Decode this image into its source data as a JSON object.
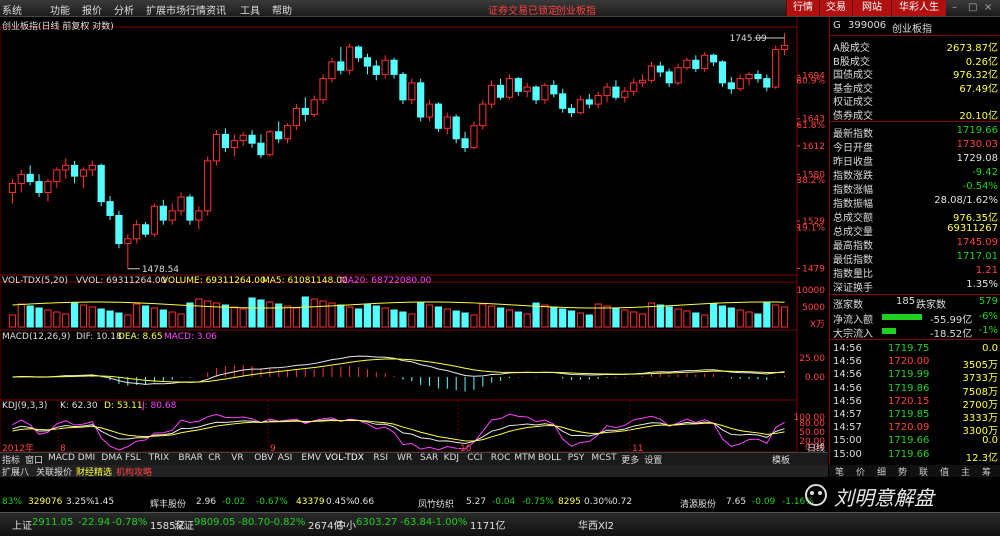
{
  "menu": {
    "items": [
      "系统",
      "功能",
      "报价",
      "分析",
      "扩展市场行情",
      "资讯",
      "工具",
      "帮助"
    ],
    "warnings": [
      "证券交易已锁定",
      "创业板指"
    ],
    "right_buttons": [
      "行情",
      "交易",
      "网站",
      "华彩人生"
    ]
  },
  "chart": {
    "title": "创业板指(日线 前复权 对数)",
    "price_labels": [
      "1694",
      "80.9%",
      "1643",
      "61.8%",
      "1612",
      "1580",
      "38.2%",
      "1529",
      "19.1%",
      "1479"
    ],
    "high_marker": "1745.09",
    "low_marker": "1478.54",
    "vol_header": {
      "name": "VOL-TDX(5,20)",
      "vvol": "VVOL: 69311264.00",
      "volume": "VOLUME: 69311264.00",
      "ma5": "MA5: 61081148.00",
      "ma20": "MA20: 68722080.00"
    },
    "vol_axis": [
      "10000",
      "5000",
      "X万"
    ],
    "macd_header": {
      "name": "MACD(12,26,9)",
      "dif": "DIF: 10.18",
      "dea": "DEA: 8.65",
      "macd": "MACD: 3.06"
    },
    "macd_axis": [
      "25.00",
      "0.00"
    ],
    "kdj_header": {
      "name": "KDJ(9,3,3)",
      "k": "K: 62.30",
      "d": "D: 53.11",
      "j": "J: 80.68"
    },
    "kdj_axis": [
      "100.00",
      "80.00",
      "50.00",
      "20.00",
      "0.00"
    ],
    "x_labels": [
      "2012年",
      "8",
      "9",
      "10",
      "11"
    ],
    "period": "日线"
  },
  "chart_data": {
    "type": "candlestick",
    "ohlc": [
      [
        1560,
        1575,
        1548,
        1570
      ],
      [
        1570,
        1585,
        1560,
        1580
      ],
      [
        1580,
        1590,
        1568,
        1572
      ],
      [
        1572,
        1580,
        1555,
        1560
      ],
      [
        1560,
        1575,
        1550,
        1572
      ],
      [
        1572,
        1588,
        1565,
        1585
      ],
      [
        1585,
        1598,
        1575,
        1590
      ],
      [
        1590,
        1595,
        1570,
        1578
      ],
      [
        1578,
        1588,
        1565,
        1585
      ],
      [
        1585,
        1595,
        1578,
        1590
      ],
      [
        1590,
        1592,
        1545,
        1550
      ],
      [
        1550,
        1556,
        1530,
        1535
      ],
      [
        1535,
        1540,
        1500,
        1505
      ],
      [
        1505,
        1515,
        1478.54,
        1510
      ],
      [
        1510,
        1530,
        1505,
        1525
      ],
      [
        1525,
        1528,
        1512,
        1515
      ],
      [
        1515,
        1548,
        1512,
        1545
      ],
      [
        1545,
        1552,
        1525,
        1530
      ],
      [
        1530,
        1548,
        1525,
        1540
      ],
      [
        1540,
        1560,
        1535,
        1555
      ],
      [
        1555,
        1558,
        1525,
        1530
      ],
      [
        1530,
        1545,
        1520,
        1540
      ],
      [
        1540,
        1600,
        1535,
        1595
      ],
      [
        1595,
        1630,
        1590,
        1625
      ],
      [
        1625,
        1632,
        1605,
        1610
      ],
      [
        1610,
        1625,
        1600,
        1618
      ],
      [
        1618,
        1628,
        1612,
        1624
      ],
      [
        1624,
        1630,
        1610,
        1615
      ],
      [
        1615,
        1625,
        1598,
        1602
      ],
      [
        1602,
        1630,
        1600,
        1628
      ],
      [
        1628,
        1640,
        1615,
        1620
      ],
      [
        1620,
        1638,
        1615,
        1635
      ],
      [
        1635,
        1660,
        1630,
        1655
      ],
      [
        1655,
        1668,
        1640,
        1648
      ],
      [
        1648,
        1670,
        1645,
        1665
      ],
      [
        1665,
        1695,
        1660,
        1690
      ],
      [
        1690,
        1715,
        1685,
        1710
      ],
      [
        1710,
        1728,
        1695,
        1700
      ],
      [
        1700,
        1732,
        1695,
        1728
      ],
      [
        1728,
        1730,
        1710,
        1715
      ],
      [
        1715,
        1720,
        1695,
        1705
      ],
      [
        1705,
        1712,
        1688,
        1695
      ],
      [
        1695,
        1718,
        1690,
        1712
      ],
      [
        1712,
        1715,
        1690,
        1695
      ],
      [
        1695,
        1698,
        1660,
        1665
      ],
      [
        1665,
        1690,
        1660,
        1685
      ],
      [
        1685,
        1690,
        1640,
        1645
      ],
      [
        1645,
        1665,
        1640,
        1660
      ],
      [
        1660,
        1662,
        1628,
        1632
      ],
      [
        1632,
        1650,
        1625,
        1645
      ],
      [
        1645,
        1648,
        1615,
        1620
      ],
      [
        1620,
        1628,
        1605,
        1610
      ],
      [
        1610,
        1640,
        1608,
        1635
      ],
      [
        1635,
        1665,
        1630,
        1660
      ],
      [
        1660,
        1688,
        1655,
        1682
      ],
      [
        1682,
        1690,
        1665,
        1668
      ],
      [
        1668,
        1695,
        1665,
        1690
      ],
      [
        1690,
        1692,
        1670,
        1675
      ],
      [
        1675,
        1685,
        1668,
        1680
      ],
      [
        1680,
        1682,
        1660,
        1665
      ],
      [
        1665,
        1685,
        1660,
        1682
      ],
      [
        1682,
        1688,
        1668,
        1672
      ],
      [
        1672,
        1678,
        1650,
        1655
      ],
      [
        1655,
        1660,
        1645,
        1650
      ],
      [
        1650,
        1670,
        1648,
        1665
      ],
      [
        1665,
        1672,
        1655,
        1660
      ],
      [
        1660,
        1675,
        1655,
        1670
      ],
      [
        1670,
        1685,
        1662,
        1680
      ],
      [
        1680,
        1688,
        1665,
        1668
      ],
      [
        1668,
        1680,
        1662,
        1675
      ],
      [
        1675,
        1690,
        1670,
        1685
      ],
      [
        1685,
        1695,
        1680,
        1688
      ],
      [
        1688,
        1710,
        1685,
        1705
      ],
      [
        1705,
        1710,
        1692,
        1698
      ],
      [
        1698,
        1702,
        1680,
        1685
      ],
      [
        1685,
        1708,
        1682,
        1703
      ],
      [
        1703,
        1715,
        1700,
        1712
      ],
      [
        1712,
        1718,
        1698,
        1702
      ],
      [
        1702,
        1722,
        1698,
        1718
      ],
      [
        1718,
        1720,
        1705,
        1710
      ],
      [
        1710,
        1712,
        1680,
        1685
      ],
      [
        1685,
        1692,
        1672,
        1678
      ],
      [
        1678,
        1695,
        1675,
        1690
      ],
      [
        1690,
        1698,
        1682,
        1695
      ],
      [
        1695,
        1700,
        1685,
        1690
      ],
      [
        1690,
        1695,
        1675,
        1680
      ],
      [
        1680,
        1730,
        1678,
        1725
      ],
      [
        1725,
        1745.09,
        1718,
        1730
      ]
    ],
    "ylim": [
      1470,
      1750
    ]
  },
  "sidepanel": {
    "code": "399006",
    "name": "创业板指",
    "rows": [
      {
        "k": "A股成交",
        "v": "2673.87亿",
        "c": "yl"
      },
      {
        "k": "B股成交",
        "v": "0.26亿",
        "c": "yl"
      },
      {
        "k": "国债成交",
        "v": "976.32亿",
        "c": "yl"
      },
      {
        "k": "基金成交",
        "v": "67.49亿",
        "c": "yl"
      },
      {
        "k": "权证成交",
        "v": "",
        "c": "yl"
      },
      {
        "k": "债券成交",
        "v": "20.10亿",
        "c": "yl"
      }
    ],
    "quote": [
      {
        "k": "最新指数",
        "v": "1719.66",
        "c": "gr"
      },
      {
        "k": "今日开盘",
        "v": "1730.03",
        "c": "rd"
      },
      {
        "k": "昨日收盘",
        "v": "1729.08",
        "c": "wh"
      },
      {
        "k": "指数涨跌",
        "v": "-9.42",
        "c": "gr"
      },
      {
        "k": "指数涨幅",
        "v": "-0.54%",
        "c": "gr"
      },
      {
        "k": "指数振幅",
        "v": "28.08/1.62%",
        "c": "wh"
      },
      {
        "k": "总成交额",
        "v": "976.35亿",
        "c": "yl"
      },
      {
        "k": "总成交量",
        "v": "69311267",
        "c": "yl"
      },
      {
        "k": "最高指数",
        "v": "1745.09",
        "c": "rd"
      },
      {
        "k": "最低指数",
        "v": "1717.01",
        "c": "gr"
      },
      {
        "k": "指数量比",
        "v": "1.21",
        "c": "rd"
      },
      {
        "k": "深证换手",
        "v": "1.35%",
        "c": "wh"
      }
    ],
    "updown": {
      "up_label": "涨家数",
      "up": "185",
      "down_label": "跌家数",
      "down": "579"
    },
    "flows": [
      {
        "k": "净流入额",
        "v": "-55.99亿",
        "p": "-6%"
      },
      {
        "k": "大宗流入",
        "v": "-18.52亿",
        "p": "-1%"
      }
    ],
    "ticks": [
      [
        "14:56",
        "1719.75",
        "0.0"
      ],
      [
        "14:56",
        "1720.00",
        "3505万"
      ],
      [
        "14:56",
        "1719.99",
        "3733万"
      ],
      [
        "14:56",
        "1719.86",
        "7508万"
      ],
      [
        "14:56",
        "1720.15",
        "2700万"
      ],
      [
        "14:57",
        "1719.85",
        "3333万"
      ],
      [
        "14:57",
        "1720.09",
        "3300万"
      ],
      [
        "15:00",
        "1719.66",
        "0.0"
      ],
      [
        "15:00",
        "1719.66",
        "12.3亿"
      ]
    ],
    "bottom_tabs": [
      "笔",
      "价",
      "细",
      "势",
      "联",
      "值",
      "主",
      "筹"
    ]
  },
  "tabs": [
    "指标",
    "窗口",
    "MACD",
    "DMI",
    "DMA",
    "FSL",
    "TRIX",
    "BRAR",
    "CR",
    "VR",
    "OBV",
    "ASI",
    "EMV",
    "VOL-TDX",
    "RSI",
    "WR",
    "SAR",
    "KDJ",
    "CCI",
    "ROC",
    "MTM",
    "BOLL",
    "PSY",
    "MCST",
    "更多",
    "设置"
  ],
  "subtabs": [
    "扩展八",
    "关联报价",
    "财经精选",
    "机构攻略"
  ],
  "right_tab": "模板",
  "ticker": [
    {
      "t": "83%",
      "c": "gr"
    },
    {
      "t": "329076",
      "c": "yl"
    },
    {
      "t": "3.25%",
      "c": "wh"
    },
    {
      "t": "1.45",
      "c": "wh"
    },
    {
      "t": "辉丰股份",
      "c": "wh"
    },
    {
      "t": "2.96",
      "c": "wh"
    },
    {
      "t": "-0.02",
      "c": "gr"
    },
    {
      "t": "-0.67%",
      "c": "gr"
    },
    {
      "t": "43379",
      "c": "yl"
    },
    {
      "t": "0.45%",
      "c": "wh"
    },
    {
      "t": "0.66",
      "c": "wh"
    },
    {
      "t": "凤竹纺织",
      "c": "wh"
    },
    {
      "t": "5.27",
      "c": "wh"
    },
    {
      "t": "-0.04",
      "c": "gr"
    },
    {
      "t": "-0.75%",
      "c": "gr"
    },
    {
      "t": "8295",
      "c": "yl"
    },
    {
      "t": "0.30%",
      "c": "wh"
    },
    {
      "t": "0.72",
      "c": "wh"
    },
    {
      "t": "清源股份",
      "c": "wh"
    },
    {
      "t": "7.65",
      "c": "wh"
    },
    {
      "t": "-0.09",
      "c": "gr"
    },
    {
      "t": "-1.16%",
      "c": "gr"
    }
  ],
  "status": [
    {
      "t": "上证",
      "c": "wh"
    },
    {
      "t": "2911.05",
      "c": "gr"
    },
    {
      "t": "-22.94",
      "c": "gr"
    },
    {
      "t": "-0.78%",
      "c": "gr"
    },
    {
      "t": "1585亿",
      "c": "wh"
    },
    {
      "t": "深证",
      "c": "wh"
    },
    {
      "t": "9809.05",
      "c": "gr"
    },
    {
      "t": "-80.70",
      "c": "gr"
    },
    {
      "t": "-0.82%",
      "c": "gr"
    },
    {
      "t": "2674亿",
      "c": "wh"
    },
    {
      "t": "中小",
      "c": "wh"
    },
    {
      "t": "6303.27",
      "c": "gr"
    },
    {
      "t": "-63.84",
      "c": "gr"
    },
    {
      "t": "-1.00%",
      "c": "gr"
    },
    {
      "t": "1171亿",
      "c": "wh"
    },
    {
      "t": "华西Xl2",
      "c": "wh"
    }
  ],
  "watermark": "刘明意解盘"
}
